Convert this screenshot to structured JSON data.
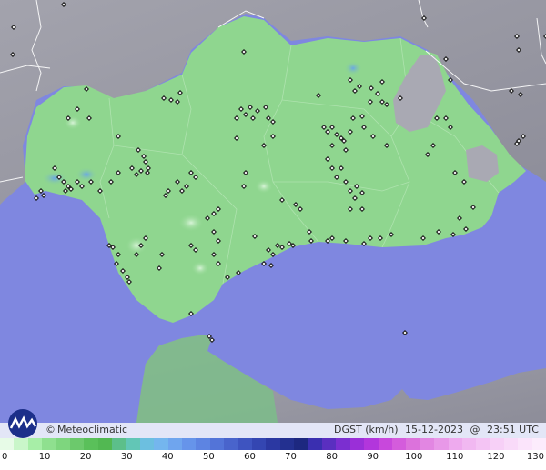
{
  "caption": {
    "parameter": "DGST (km/h)",
    "date": "15-12-2023",
    "at": "@",
    "time": "23:51 UTC"
  },
  "credit": {
    "symbol": "©",
    "name": "Meteoclimatic"
  },
  "scale": {
    "ticks": [
      "0",
      "10",
      "20",
      "30",
      "40",
      "50",
      "60",
      "70",
      "80",
      "90",
      "100",
      "110",
      "120",
      "130"
    ],
    "colors": [
      "#e7fbe7",
      "#c9f6c9",
      "#a7eea7",
      "#8fe08f",
      "#7ed67e",
      "#6cc96c",
      "#5ac05a",
      "#52b852",
      "#5cbf8a",
      "#62c6b6",
      "#6cbfe0",
      "#74b6ee",
      "#6fa5ee",
      "#6694ea",
      "#5d84e2",
      "#5374d8",
      "#4964cc",
      "#3e54c0",
      "#3446b2",
      "#2b38a2",
      "#233090",
      "#1d2880",
      "#3a2fb0",
      "#5a2fc0",
      "#7b2fd0",
      "#9a2fd8",
      "#b236dc",
      "#c848dc",
      "#d45cdc",
      "#dc72dc",
      "#e286e2",
      "#e898e8",
      "#eeaaee",
      "#f1b8f1",
      "#f4c4f4",
      "#f7d0f7",
      "#f9daf9",
      "#fbe4fb",
      "#fcecfc"
    ]
  },
  "map": {
    "sea_color": "#7f87e0",
    "land_outside_color": "#9a9aa8",
    "region_color": "#8fd68f",
    "snow_color": "#a9a9b3"
  }
}
